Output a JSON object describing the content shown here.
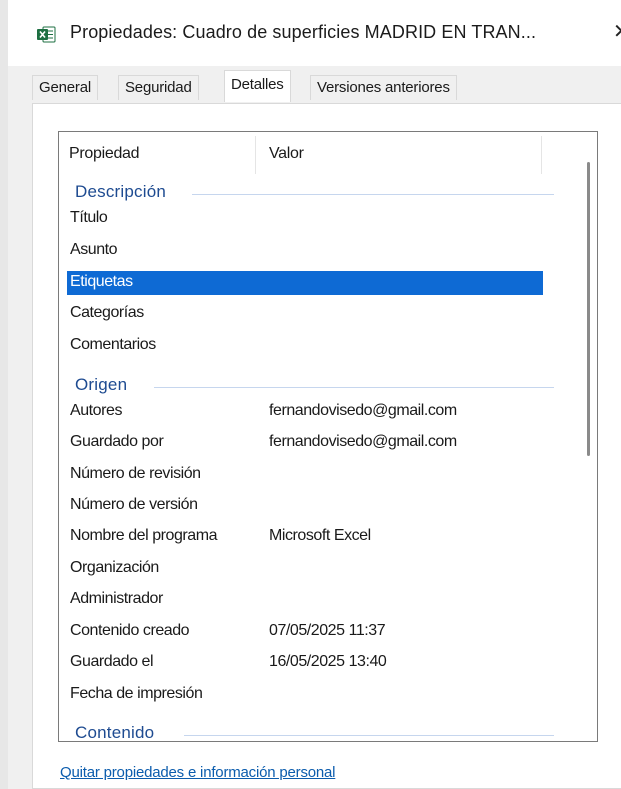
{
  "window": {
    "title": "Propiedades: Cuadro de superficies MADRID EN TRAN...",
    "close_glyph": "✕",
    "app_icon": "excel-icon",
    "excel_green": "#1d6f42"
  },
  "tabs": [
    {
      "label": "General",
      "active": false
    },
    {
      "label": "Seguridad",
      "active": false
    },
    {
      "label": "Detalles",
      "active": true
    },
    {
      "label": "Versiones anteriores",
      "active": false
    }
  ],
  "list": {
    "header": {
      "property": "Propiedad",
      "value": "Valor"
    },
    "groups": [
      {
        "label": "Descripción",
        "rows": [
          {
            "name": "Título",
            "value": ""
          },
          {
            "name": "Asunto",
            "value": ""
          },
          {
            "name": "Etiquetas",
            "value": "",
            "selected": true
          },
          {
            "name": "Categorías",
            "value": ""
          },
          {
            "name": "Comentarios",
            "value": ""
          }
        ]
      },
      {
        "label": "Origen",
        "rows": [
          {
            "name": "Autores",
            "value": "fernandovisedo@gmail.com"
          },
          {
            "name": "Guardado por",
            "value": "fernandovisedo@gmail.com"
          },
          {
            "name": "Número de revisión",
            "value": ""
          },
          {
            "name": "Número de versión",
            "value": ""
          },
          {
            "name": "Nombre del programa",
            "value": "Microsoft Excel"
          },
          {
            "name": "Organización",
            "value": ""
          },
          {
            "name": "Administrador",
            "value": ""
          },
          {
            "name": "Contenido creado",
            "value": "07/05/2025 11:37"
          },
          {
            "name": "Guardado el",
            "value": "16/05/2025 13:40"
          },
          {
            "name": "Fecha de impresión",
            "value": ""
          }
        ]
      },
      {
        "label": "Contenido",
        "rows": []
      }
    ],
    "selection_color": "#0e6ad4",
    "group_color": "#1e4b91"
  },
  "footer": {
    "link": "Quitar propiedades e información personal",
    "link_color": "#0b5cad"
  }
}
